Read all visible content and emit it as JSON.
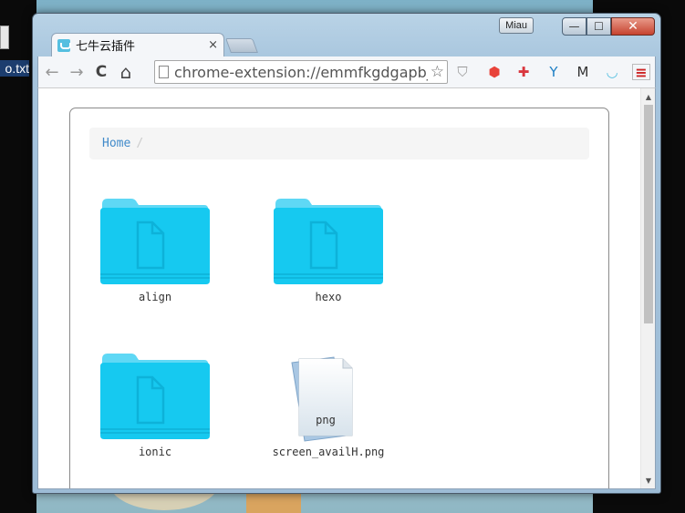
{
  "desktop": {
    "file_label": "o.txt"
  },
  "window": {
    "profile_name": "Miau",
    "min_glyph": "—",
    "max_glyph": "☐",
    "close_glyph": "✕"
  },
  "tab": {
    "title": "七牛云插件",
    "close_glyph": "×"
  },
  "toolbar": {
    "back_glyph": "←",
    "forward_glyph": "→",
    "reload_glyph": "C",
    "home_glyph": "⌂",
    "url": "chrome-extension://emmfkgdgapbj",
    "star_glyph": "☆",
    "extensions": [
      {
        "name": "shield-extension-icon",
        "glyph": "⛉",
        "color": "#9a9a9a"
      },
      {
        "name": "red-hex-extension-icon",
        "glyph": "⬢",
        "color": "#e8433a"
      },
      {
        "name": "red-cross-extension-icon",
        "glyph": "✚",
        "color": "#d9363e"
      },
      {
        "name": "y-extension-icon",
        "glyph": "Y",
        "color": "#1e7fc4"
      },
      {
        "name": "m-extension-icon",
        "glyph": "M",
        "color": "#333333"
      },
      {
        "name": "qiniu-extension-icon",
        "glyph": "◡",
        "color": "#55bfe0"
      },
      {
        "name": "menu-icon",
        "glyph": "≡",
        "color": "#cc2222"
      }
    ]
  },
  "breadcrumb": {
    "home": "Home",
    "separator": "/"
  },
  "items": [
    {
      "name": "align",
      "type": "folder"
    },
    {
      "name": "hexo",
      "type": "folder"
    },
    {
      "name": "ionic",
      "type": "folder"
    },
    {
      "name": "screen_availH.png",
      "type": "file",
      "ext": "png"
    }
  ],
  "colors": {
    "folder_top": "#5fd8f5",
    "folder_body": "#16c9f0",
    "link": "#428bca"
  }
}
